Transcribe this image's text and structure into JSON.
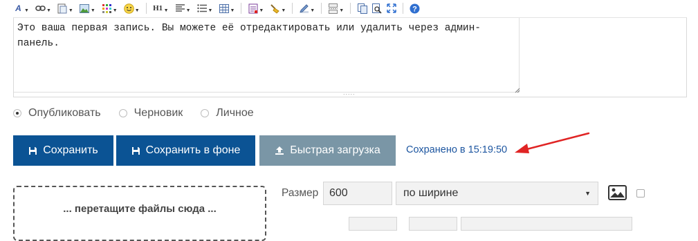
{
  "editor": {
    "content": "Это ваша первая запись. Вы можете её отредактировать или удалить через админ-панель."
  },
  "status": {
    "options": [
      "Опубликовать",
      "Черновик",
      "Личное"
    ],
    "selected": "Опубликовать"
  },
  "actions": {
    "save_label": "Сохранить",
    "save_background_label": "Сохранить в фоне",
    "quick_upload_label": "Быстрая загрузка",
    "saved_status": "Сохранено в 15:19:50"
  },
  "upload": {
    "dropzone_label": "... перетащите файлы сюда ...",
    "size_label": "Размер",
    "size_value": "600",
    "fit_mode": "по ширине"
  },
  "colors": {
    "primary_button": "#0b5394",
    "secondary_button": "#7a96a6",
    "saved_text": "#1d56a0",
    "annotation_arrow": "#e02424"
  }
}
